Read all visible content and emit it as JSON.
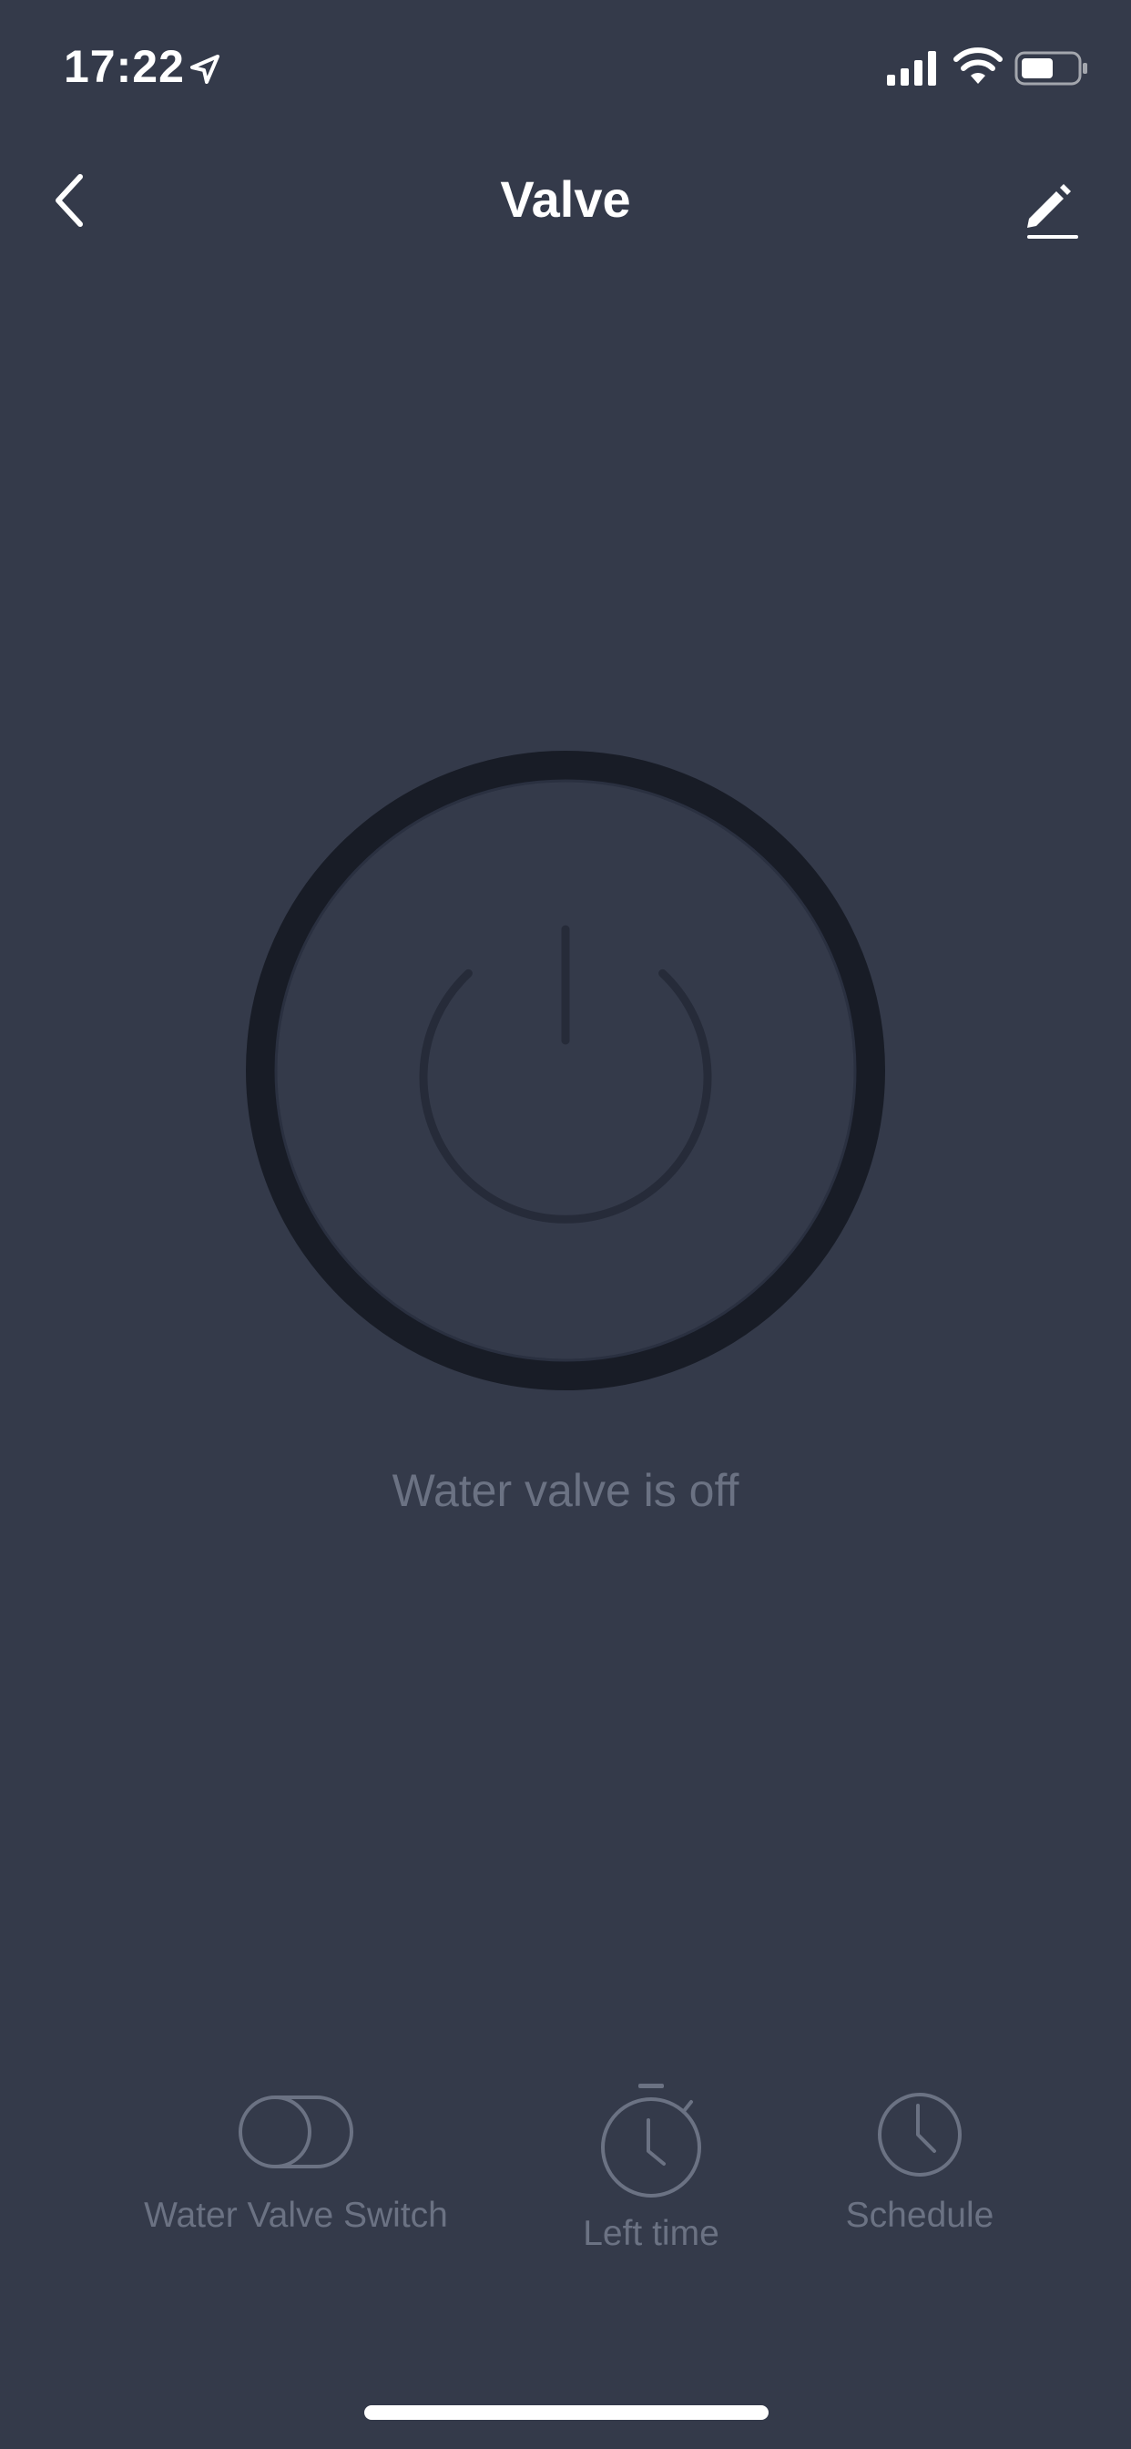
{
  "status_bar": {
    "time": "17:22"
  },
  "nav": {
    "title": "Valve"
  },
  "valve": {
    "status_text": "Water valve is off"
  },
  "controls": [
    {
      "label": "Water Valve Switch",
      "icon": "toggle-switch-icon"
    },
    {
      "label": "Left time",
      "icon": "stopwatch-icon"
    },
    {
      "label": "Schedule",
      "icon": "clock-icon"
    }
  ],
  "colors": {
    "background": "#343a4a",
    "ring": "#181c26",
    "muted_text": "#6b7283",
    "icon_muted": "#6b7283"
  }
}
